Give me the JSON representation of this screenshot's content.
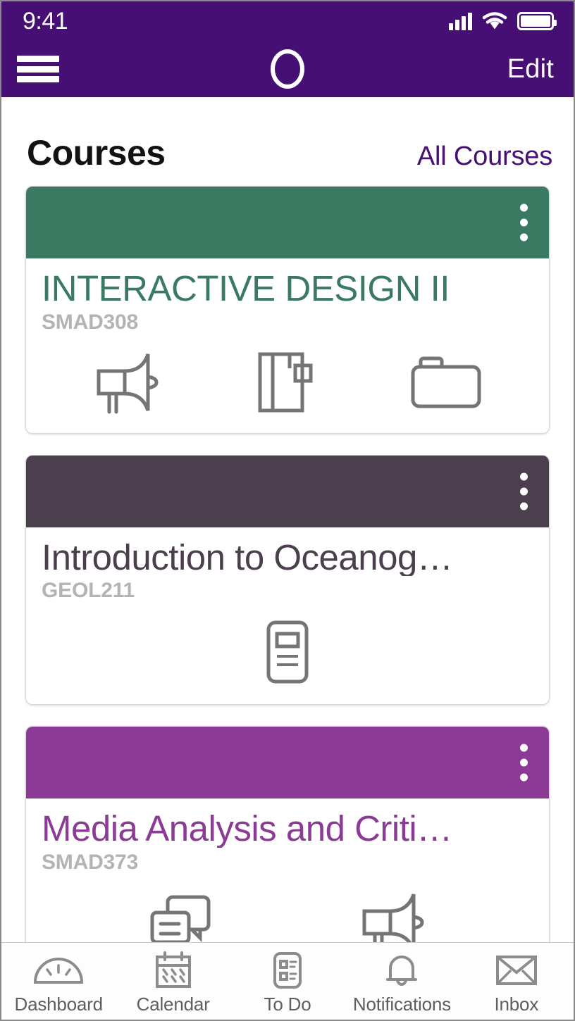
{
  "status_bar": {
    "time": "9:41",
    "signal_icon": "cellular-signal-icon",
    "wifi_icon": "wifi-icon",
    "battery_icon": "battery-full-icon"
  },
  "nav_bar": {
    "menu_icon": "hamburger-menu-icon",
    "logo_icon": "canvas-circle-logo-icon",
    "edit_label": "Edit",
    "background_color": "#460F73"
  },
  "header": {
    "title": "Courses",
    "all_courses_label": "All Courses",
    "all_courses_color": "#460F73"
  },
  "courses": [
    {
      "title": "INTERACTIVE DESIGN II",
      "code": "SMAD308",
      "color": "#3A7A63",
      "kebab_icon": "more-options-icon",
      "shortcuts": [
        {
          "icon": "announcements-megaphone-icon"
        },
        {
          "icon": "pages-book-icon"
        },
        {
          "icon": "files-folder-icon"
        }
      ]
    },
    {
      "title": "Introduction to Oceanog…",
      "code": "GEOL211",
      "color": "#4B3F4E",
      "kebab_icon": "more-options-icon",
      "shortcuts": [
        {
          "icon": "syllabus-document-icon"
        }
      ]
    },
    {
      "title": "Media Analysis and Criti…",
      "code": "SMAD373",
      "color": "#8B3A96",
      "kebab_icon": "more-options-icon",
      "shortcuts": [
        {
          "icon": "discussions-icon"
        },
        {
          "icon": "announcements-megaphone-icon"
        }
      ]
    }
  ],
  "tab_bar": {
    "items": [
      {
        "label": "Dashboard",
        "icon": "dashboard-gauge-icon"
      },
      {
        "label": "Calendar",
        "icon": "calendar-icon"
      },
      {
        "label": "To Do",
        "icon": "todo-list-icon"
      },
      {
        "label": "Notifications",
        "icon": "bell-icon"
      },
      {
        "label": "Inbox",
        "icon": "envelope-icon"
      }
    ]
  }
}
